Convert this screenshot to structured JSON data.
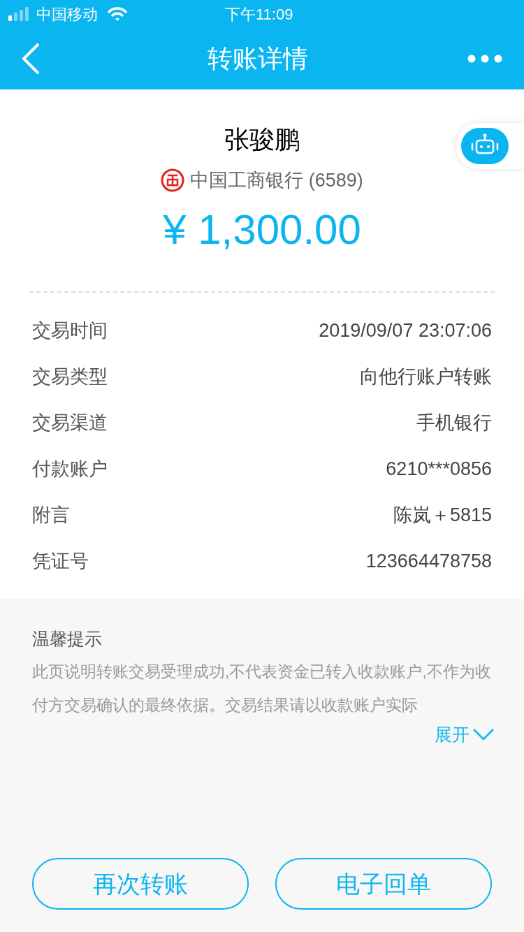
{
  "status_bar": {
    "carrier": "中国移动",
    "time": "下午11:09"
  },
  "nav": {
    "title": "转账详情"
  },
  "payee": {
    "name": "张骏鹏",
    "bank": "中国工商银行 (6589)",
    "amount": "¥ 1,300.00"
  },
  "details": [
    {
      "label": "交易时间",
      "value": "2019/09/07 23:07:06"
    },
    {
      "label": "交易类型",
      "value": "向他行账户转账"
    },
    {
      "label": "交易渠道",
      "value": "手机银行"
    },
    {
      "label": "付款账户",
      "value": "6210***0856"
    },
    {
      "label": "附言",
      "value": "陈岚＋5815"
    },
    {
      "label": "凭证号",
      "value": "123664478758"
    }
  ],
  "notice": {
    "title": "温馨提示",
    "text": "此页说明转账交易受理成功,不代表资金已转入收款账户,不作为收付方交易确认的最终依据。交易结果请以收款账户实际",
    "expand": "展开"
  },
  "buttons": [
    "再次转账",
    "电子回单"
  ]
}
